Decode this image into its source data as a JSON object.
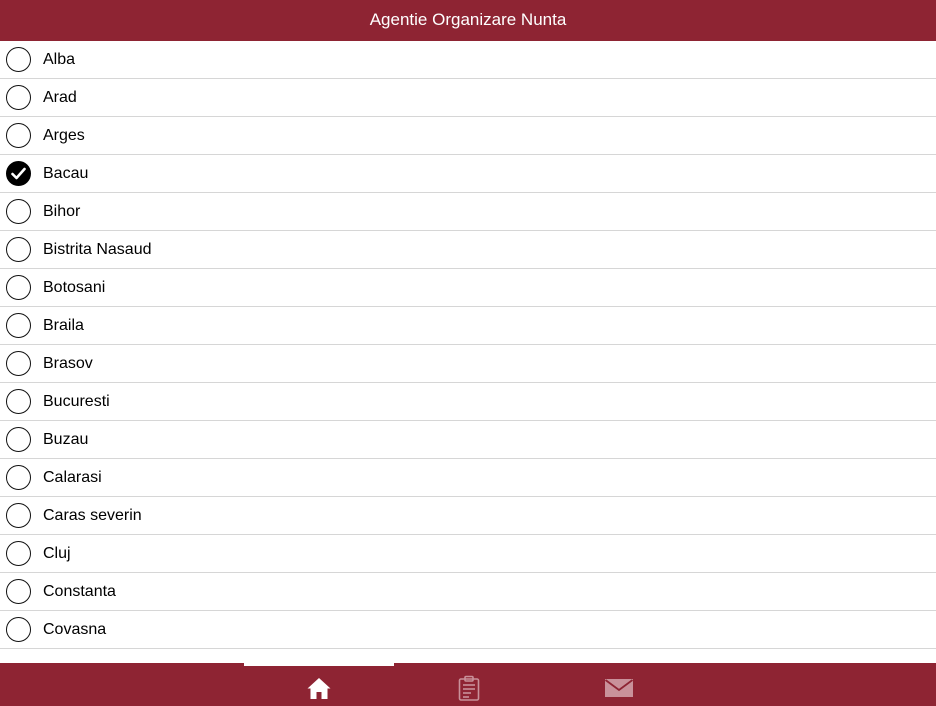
{
  "header": {
    "title": "Agentie Organizare Nunta"
  },
  "counties": [
    {
      "label": "Alba",
      "selected": false
    },
    {
      "label": "Arad",
      "selected": false
    },
    {
      "label": "Arges",
      "selected": false
    },
    {
      "label": "Bacau",
      "selected": true
    },
    {
      "label": "Bihor",
      "selected": false
    },
    {
      "label": "Bistrita Nasaud",
      "selected": false
    },
    {
      "label": "Botosani",
      "selected": false
    },
    {
      "label": "Braila",
      "selected": false
    },
    {
      "label": "Brasov",
      "selected": false
    },
    {
      "label": "Bucuresti",
      "selected": false
    },
    {
      "label": "Buzau",
      "selected": false
    },
    {
      "label": "Calarasi",
      "selected": false
    },
    {
      "label": "Caras severin",
      "selected": false
    },
    {
      "label": "Cluj",
      "selected": false
    },
    {
      "label": "Constanta",
      "selected": false
    },
    {
      "label": "Covasna",
      "selected": false
    }
  ],
  "tabbar": {
    "tabs": [
      {
        "icon": "home-icon",
        "active": true
      },
      {
        "icon": "clipboard-icon",
        "active": false
      },
      {
        "icon": "mail-icon",
        "active": false
      }
    ]
  },
  "colors": {
    "brand": "#8e2433",
    "inactive_icon": "#c9919a",
    "active_icon": "#ffffff"
  }
}
